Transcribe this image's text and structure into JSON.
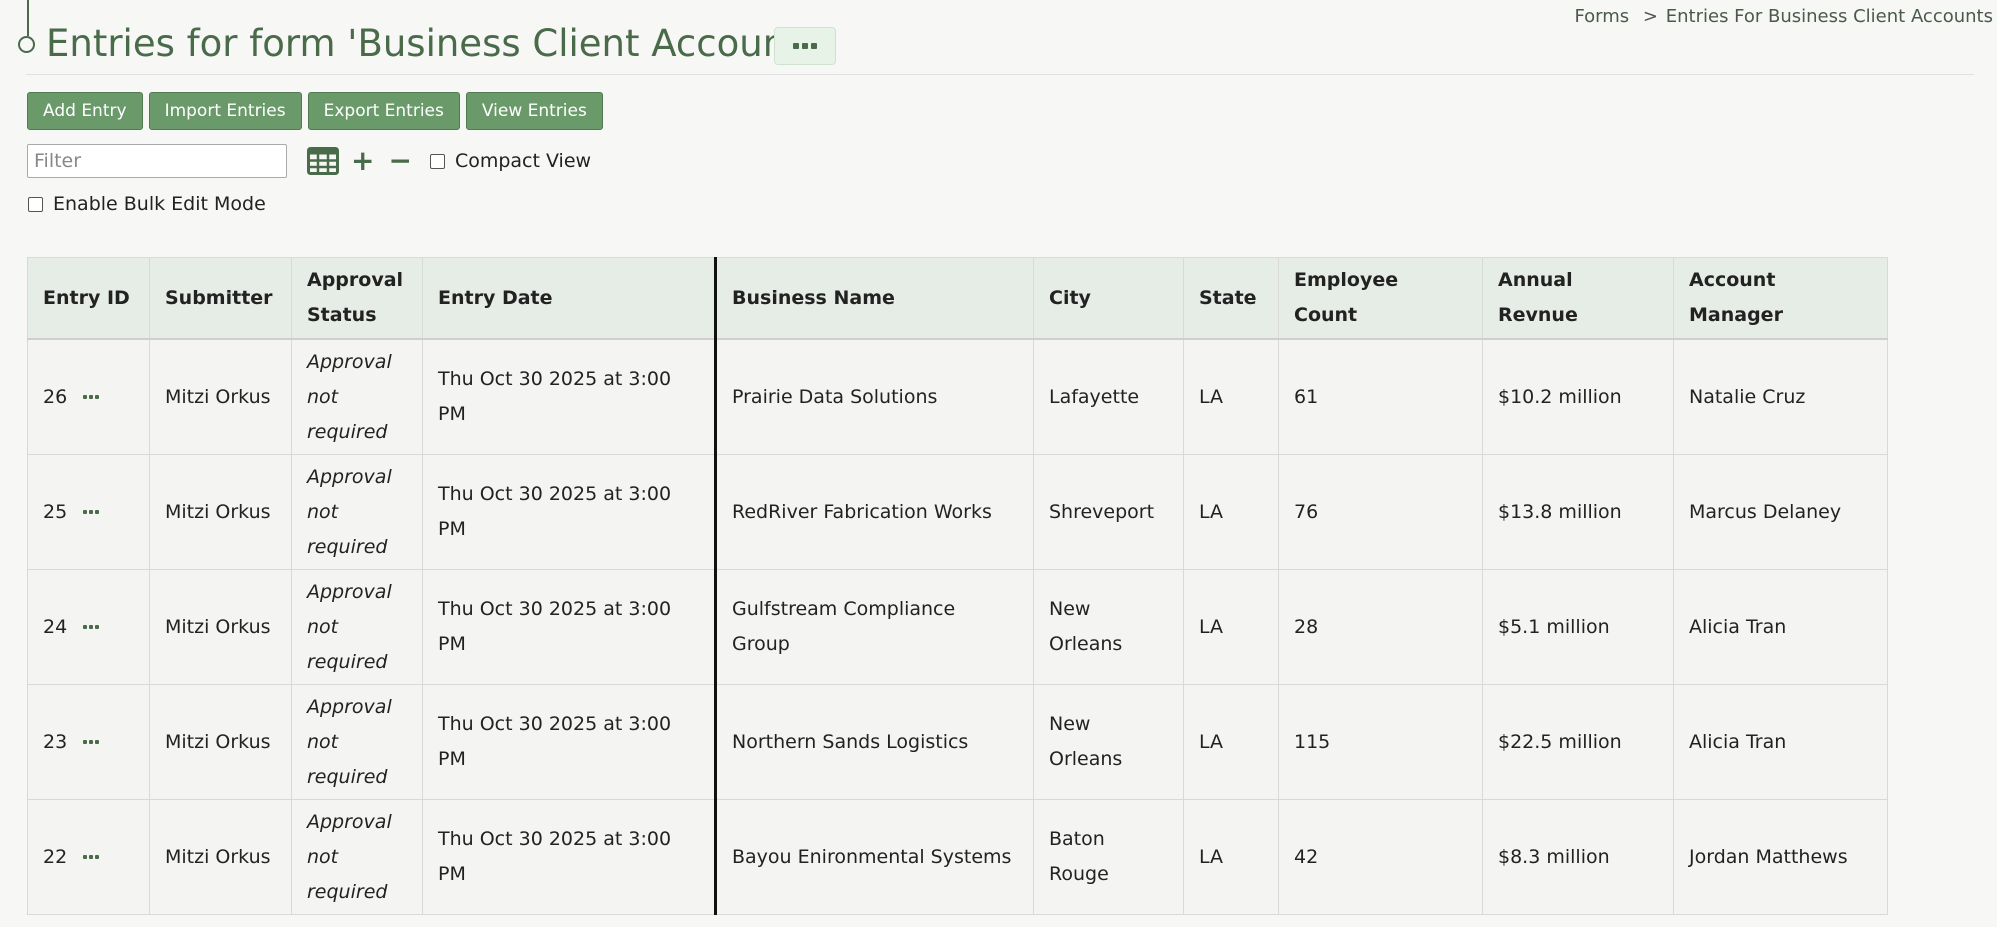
{
  "header": {
    "title": "Entries for form 'Business Client Accounts'",
    "more_label": "more options"
  },
  "breadcrumb": {
    "items": [
      "Forms",
      "Entries For Business Client Accounts"
    ],
    "separator": ">"
  },
  "toolbar": {
    "add_entry": "Add Entry",
    "import_entries": "Import Entries",
    "export_entries": "Export Entries",
    "view_entries": "View Entries"
  },
  "filter": {
    "placeholder": "Filter",
    "value": "",
    "compact_view_label": "Compact View",
    "compact_view_checked": false
  },
  "bulk_edit": {
    "label": "Enable Bulk Edit Mode",
    "checked": false
  },
  "table": {
    "columns": [
      "Entry ID",
      "Submitter",
      "Approval Status",
      "Entry Date",
      "Business Name",
      "City",
      "State",
      "Employee Count",
      "Annual Revnue",
      "Account Manager"
    ],
    "rows": [
      {
        "id": "26",
        "submitter": "Mitzi Orkus",
        "status": "Approval not required",
        "date": "Thu Oct 30 2025 at 3:00 PM",
        "business": "Prairie Data Solutions",
        "city": "Lafayette",
        "state": "LA",
        "employees": "61",
        "revenue": "$10.2 million",
        "manager": "Natalie Cruz"
      },
      {
        "id": "25",
        "submitter": "Mitzi Orkus",
        "status": "Approval not required",
        "date": "Thu Oct 30 2025 at 3:00 PM",
        "business": "RedRiver Fabrication Works",
        "city": "Shreveport",
        "state": "LA",
        "employees": "76",
        "revenue": "$13.8 million",
        "manager": "Marcus Delaney"
      },
      {
        "id": "24",
        "submitter": "Mitzi Orkus",
        "status": "Approval not required",
        "date": "Thu Oct 30 2025 at 3:00 PM",
        "business": "Gulfstream Compliance Group",
        "city": "New Orleans",
        "state": "LA",
        "employees": "28",
        "revenue": "$5.1 million",
        "manager": "Alicia Tran"
      },
      {
        "id": "23",
        "submitter": "Mitzi Orkus",
        "status": "Approval not required",
        "date": "Thu Oct 30 2025 at 3:00 PM",
        "business": "Northern Sands Logistics",
        "city": "New Orleans",
        "state": "LA",
        "employees": "115",
        "revenue": "$22.5 million",
        "manager": "Alicia Tran"
      },
      {
        "id": "22",
        "submitter": "Mitzi Orkus",
        "status": "Approval not required",
        "date": "Thu Oct 30 2025 at 3:00 PM",
        "business": "Bayou Enironmental Systems",
        "city": "Baton Rouge",
        "state": "LA",
        "employees": "42",
        "revenue": "$8.3 million",
        "manager": "Jordan Matthews"
      }
    ]
  },
  "colors": {
    "accent": "#4a6b4a",
    "button_bg": "#6a9a6a",
    "header_bg": "#e6ece6",
    "page_bg": "#f7f7f6"
  },
  "icons": {
    "more": "ellipsis-icon",
    "grid": "table-grid-icon",
    "add_column": "plus-icon",
    "remove_column": "minus-icon"
  }
}
